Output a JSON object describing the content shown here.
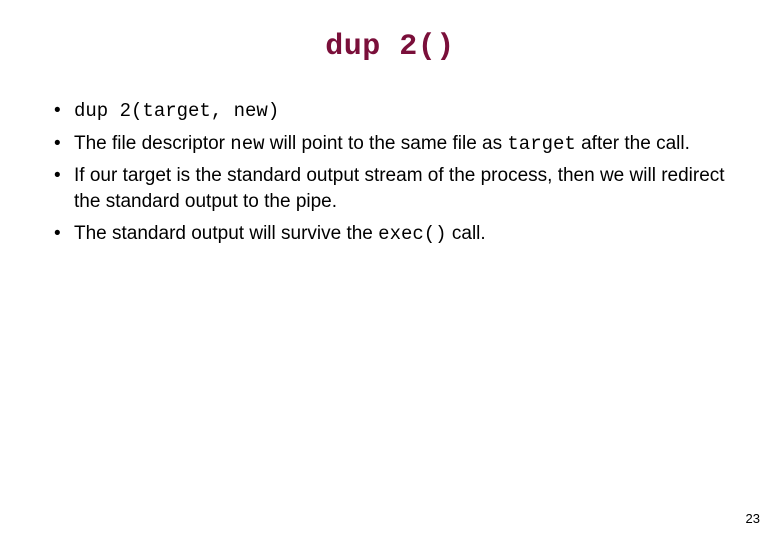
{
  "title": "dup 2()",
  "bullets": {
    "b1_code": "dup 2(target, new)",
    "b2_pre": "The file descriptor ",
    "b2_code1": "new",
    "b2_mid": " will point to the same file as ",
    "b2_code2": "target",
    "b2_post": " after the call.",
    "b3": "If our target is the standard output stream of the process, then we will redirect the standard output to the pipe.",
    "b4_pre": "The standard output will survive the ",
    "b4_code": "exec()",
    "b4_post": " call."
  },
  "page_number": "23"
}
